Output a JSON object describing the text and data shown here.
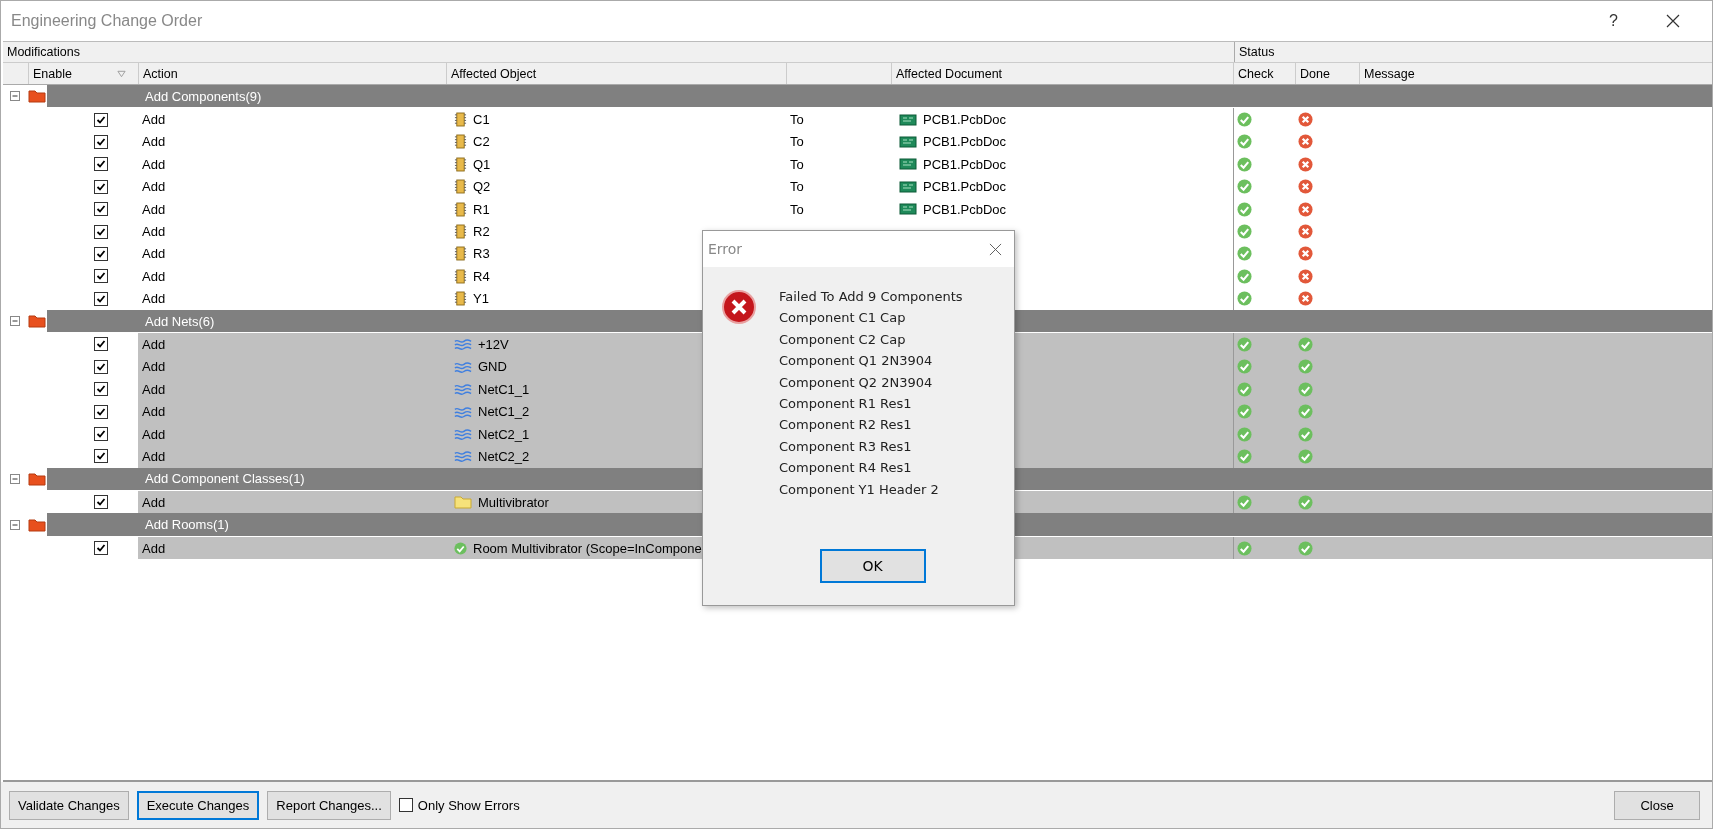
{
  "window": {
    "title": "Engineering Change Order",
    "help": "?"
  },
  "table": {
    "header_groups": [
      "Modifications",
      "Status"
    ],
    "columns": [
      "Enable",
      "Action",
      "Affected Object",
      "",
      "Affected Document",
      "Check",
      "Done",
      "Message"
    ],
    "groups": [
      {
        "label": "Add Components(9)",
        "expanded": true,
        "rows": [
          {
            "checked": true,
            "selected": false,
            "action": "Add",
            "object": "C1",
            "kind": "component",
            "to": "To",
            "document": "PCB1.PcbDoc",
            "check_passed": true,
            "done_passed": false
          },
          {
            "checked": true,
            "selected": false,
            "action": "Add",
            "object": "C2",
            "kind": "component",
            "to": "To",
            "document": "PCB1.PcbDoc",
            "check_passed": true,
            "done_passed": false
          },
          {
            "checked": true,
            "selected": false,
            "action": "Add",
            "object": "Q1",
            "kind": "component",
            "to": "To",
            "document": "PCB1.PcbDoc",
            "check_passed": true,
            "done_passed": false
          },
          {
            "checked": true,
            "selected": false,
            "action": "Add",
            "object": "Q2",
            "kind": "component",
            "to": "To",
            "document": "PCB1.PcbDoc",
            "check_passed": true,
            "done_passed": false
          },
          {
            "checked": true,
            "selected": false,
            "action": "Add",
            "object": "R1",
            "kind": "component",
            "to": "To",
            "document": "PCB1.PcbDoc",
            "check_passed": true,
            "done_passed": false
          },
          {
            "checked": true,
            "selected": false,
            "action": "Add",
            "object": "R2",
            "kind": "component",
            "check_passed": true,
            "done_passed": false
          },
          {
            "checked": true,
            "selected": false,
            "action": "Add",
            "object": "R3",
            "kind": "component",
            "check_passed": true,
            "done_passed": false
          },
          {
            "checked": true,
            "selected": false,
            "action": "Add",
            "object": "R4",
            "kind": "component",
            "check_passed": true,
            "done_passed": false
          },
          {
            "checked": true,
            "selected": false,
            "action": "Add",
            "object": "Y1",
            "kind": "component",
            "check_passed": true,
            "done_passed": false
          }
        ]
      },
      {
        "label": "Add Nets(6)",
        "expanded": true,
        "rows": [
          {
            "checked": true,
            "selected": true,
            "action": "Add",
            "object": "+12V",
            "kind": "net",
            "check_passed": true,
            "done_passed": true
          },
          {
            "checked": true,
            "selected": true,
            "action": "Add",
            "object": "GND",
            "kind": "net",
            "check_passed": true,
            "done_passed": true
          },
          {
            "checked": true,
            "selected": true,
            "action": "Add",
            "object": "NetC1_1",
            "kind": "net",
            "check_passed": true,
            "done_passed": true
          },
          {
            "checked": true,
            "selected": true,
            "action": "Add",
            "object": "NetC1_2",
            "kind": "net",
            "check_passed": true,
            "done_passed": true
          },
          {
            "checked": true,
            "selected": true,
            "action": "Add",
            "object": "NetC2_1",
            "kind": "net",
            "check_passed": true,
            "done_passed": true
          },
          {
            "checked": true,
            "selected": true,
            "action": "Add",
            "object": "NetC2_2",
            "kind": "net",
            "check_passed": true,
            "done_passed": true
          }
        ]
      },
      {
        "label": "Add Component Classes(1)",
        "expanded": true,
        "rows": [
          {
            "checked": true,
            "selected": true,
            "action": "Add",
            "object": "Multivibrator",
            "kind": "class",
            "check_passed": true,
            "done_passed": true
          }
        ]
      },
      {
        "label": "Add Rooms(1)",
        "expanded": true,
        "rows": [
          {
            "checked": true,
            "selected": true,
            "action": "Add",
            "object": "Room Multivibrator (Scope=InCompone",
            "kind": "room",
            "check_passed": true,
            "done_passed": true
          }
        ]
      }
    ]
  },
  "dialog": {
    "title": "Error",
    "lines": [
      "Failed To Add 9 Components",
      "Component C1 Cap",
      "Component C2 Cap",
      "Component Q1 2N3904",
      "Component Q2 2N3904",
      "Component R1 Res1",
      "Component R2 Res1",
      "Component R3 Res1",
      "Component R4 Res1",
      "Component Y1 Header 2"
    ],
    "button": "OK"
  },
  "footer": {
    "buttons": [
      {
        "label": "Validate Changes",
        "focused": false
      },
      {
        "label": "Execute Changes",
        "focused": true
      },
      {
        "label": "Report Changes...",
        "focused": false
      }
    ],
    "option": {
      "label": "Only Show Errors",
      "checked": false
    },
    "close": "Close"
  }
}
